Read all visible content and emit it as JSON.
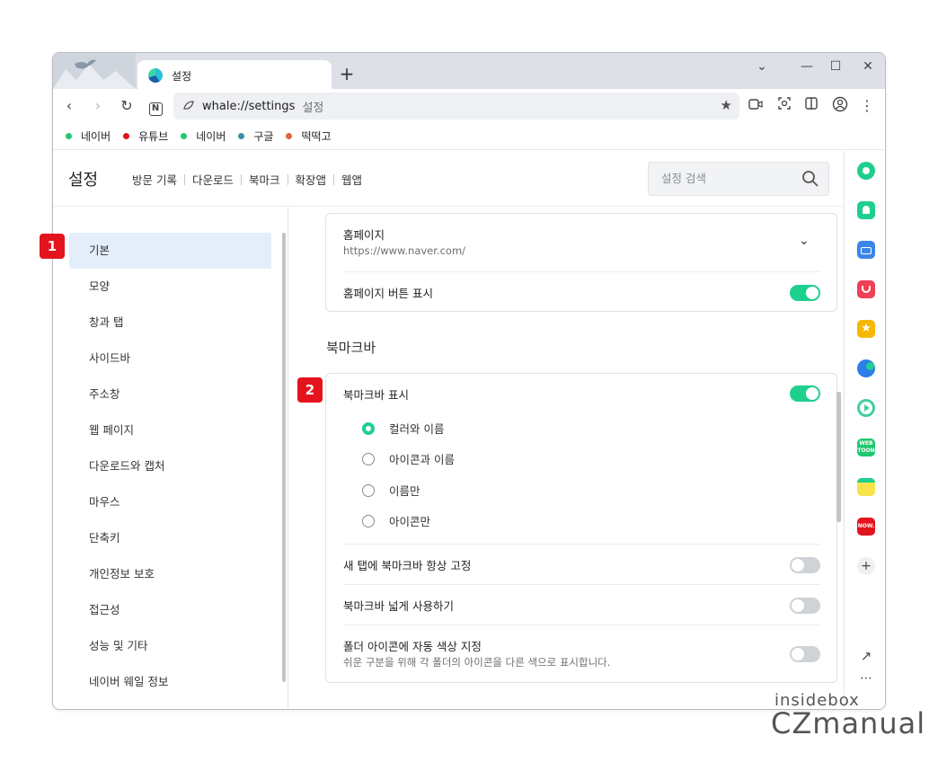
{
  "tab": {
    "title": "설정"
  },
  "toolbar": {
    "url": "whale://settings",
    "url_title": "설정"
  },
  "bookmarks": [
    {
      "label": "네이버",
      "color": "#1ec800"
    },
    {
      "label": "유튜브",
      "color": "#e3141e"
    },
    {
      "label": "네이버",
      "color": "#1ec800"
    },
    {
      "label": "구글",
      "color": "#3a8fa8"
    },
    {
      "label": "떡떡고",
      "color": "#e0643c"
    }
  ],
  "settings_header": {
    "title": "설정",
    "links": [
      "방문 기록",
      "다운로드",
      "북마크",
      "확장앱",
      "웹앱"
    ],
    "search_placeholder": "설정 검색"
  },
  "nav": {
    "items": [
      "기본",
      "모양",
      "창과 탭",
      "사이드바",
      "주소창",
      "웹 페이지",
      "다운로드와 캡처",
      "마우스",
      "단축키",
      "개인정보 보호",
      "접근성",
      "성능 및 기타",
      "네이버 웨일 정보"
    ],
    "active": "기본"
  },
  "homepage_card": {
    "homepage_label": "홈페이지",
    "homepage_url": "https://www.naver.com/",
    "home_button_label": "홈페이지 버튼 표시",
    "home_button_on": true
  },
  "bookmarkbar_section": {
    "title": "북마크바",
    "show_label": "북마크바 표시",
    "show_on": true,
    "radio_options": [
      "컬러와 이름",
      "아이콘과 이름",
      "이름만",
      "아이콘만"
    ],
    "radio_selected": "컬러와 이름",
    "pin_newtab_label": "새 탭에 북마크바 항상 고정",
    "pin_newtab_on": false,
    "wide_label": "북마크바 넓게 사용하기",
    "wide_on": false,
    "folder_color_label": "폴더 아이콘에 자동 색상 지정",
    "folder_color_desc": "쉬운 구분을 위해 각 폴더의 아이콘을 다른 색으로 표시합니다.",
    "folder_color_on": false
  },
  "badges": {
    "one": "1",
    "two": "2"
  },
  "watermark": {
    "line1": "insidebox",
    "line2": "CZmanual"
  },
  "accent_color": "#1fcf8e"
}
